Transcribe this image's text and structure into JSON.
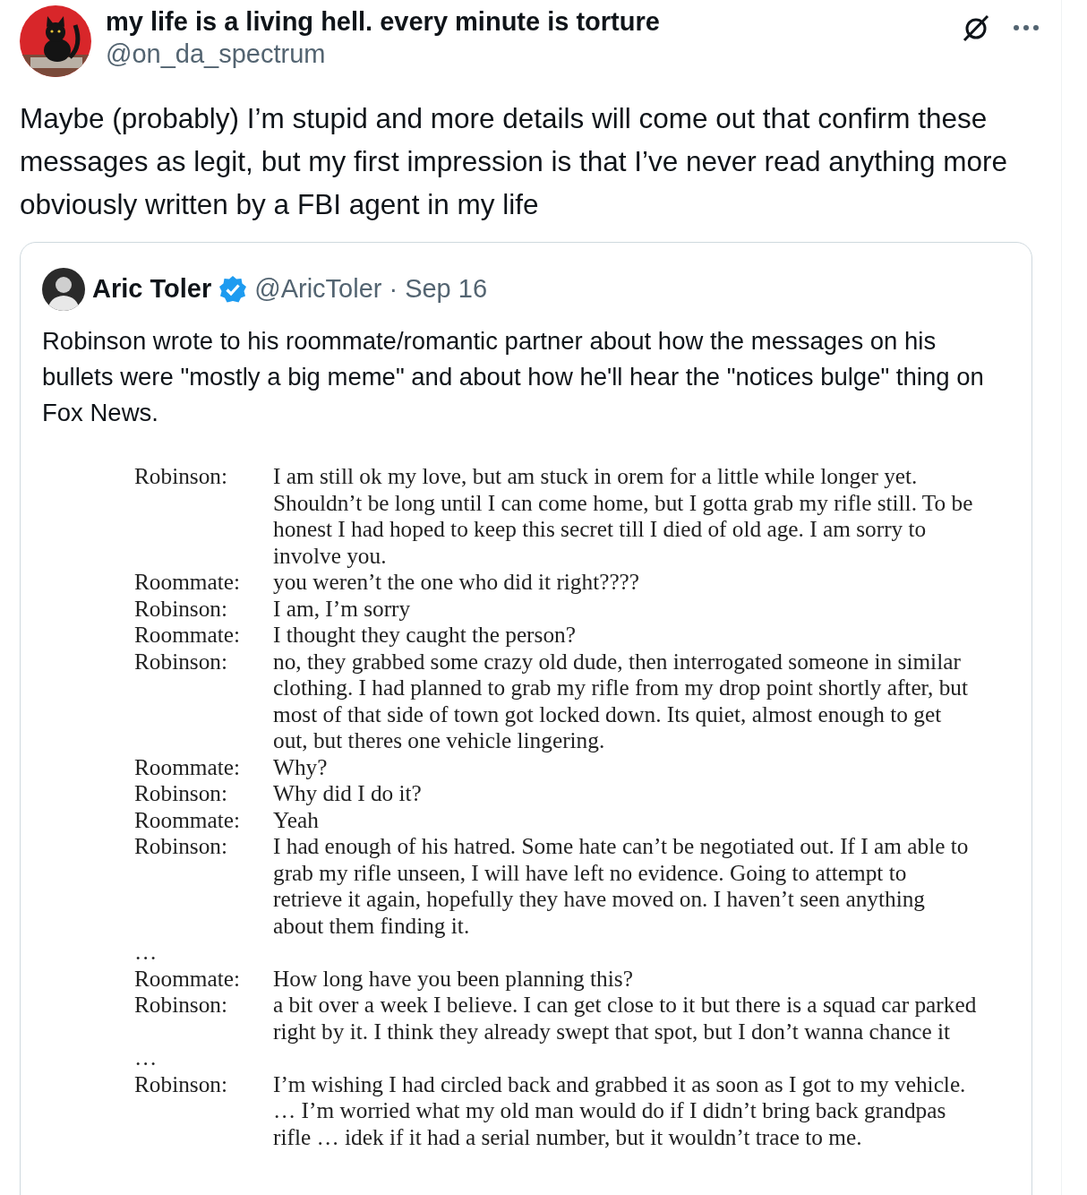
{
  "post": {
    "author": {
      "name": "my life is a living hell. every minute is torture",
      "handle": "@on_da_spectrum"
    },
    "text": "Maybe (probably) I’m stupid and more details will come out that confirm these messages as legit, but my first impression is that I’ve never read anything more obviously written by a FBI agent in my life",
    "quote": {
      "author": {
        "name": "Aric Toler",
        "verified": true,
        "handle": "@AricToler",
        "separator": "·",
        "date": "Sep 16"
      },
      "text": "Robinson wrote to his roommate/romantic partner about how the messages on his bullets were \"mostly a big meme\" and about how he'll hear the \"notices bulge\" thing on Fox News.",
      "document": {
        "entries": [
          {
            "kind": "line",
            "speaker": "Robinson:",
            "message": "I am still ok my love, but am stuck in orem for a little while longer yet. Shouldn’t be long until I can come home, but I gotta grab my rifle still. To be honest I had hoped to keep this secret till I died of old age. I am sorry to involve you."
          },
          {
            "kind": "line",
            "speaker": "Roommate:",
            "message": "you weren’t the one who did it right????"
          },
          {
            "kind": "line",
            "speaker": "Robinson:",
            "message": "I am, I’m sorry"
          },
          {
            "kind": "line",
            "speaker": "Roommate:",
            "message": "I thought they caught the person?"
          },
          {
            "kind": "line",
            "speaker": "Robinson:",
            "message": "no, they grabbed some crazy old dude, then interrogated someone in similar clothing. I had planned to grab my rifle from my drop point shortly after, but most of that side of town got locked down. Its quiet, almost enough to get out, but theres one vehicle lingering."
          },
          {
            "kind": "line",
            "speaker": "Roommate:",
            "message": "Why?"
          },
          {
            "kind": "line",
            "speaker": "Robinson:",
            "message": "Why did I do it?"
          },
          {
            "kind": "line",
            "speaker": "Roommate:",
            "message": "Yeah"
          },
          {
            "kind": "line",
            "speaker": "Robinson:",
            "message": "I had enough of his hatred. Some hate can’t be negotiated out. If I am able to grab my rifle unseen, I will have left no evidence. Going to attempt to retrieve it again, hopefully they have moved on. I haven’t seen anything about them finding it."
          },
          {
            "kind": "ellipsis",
            "text": "…"
          },
          {
            "kind": "line",
            "speaker": "Roommate:",
            "message": "How long have you been planning this?"
          },
          {
            "kind": "line",
            "speaker": "Robinson:",
            "message": "a bit over a week I believe. I can get close to it but there is a squad car parked right by it. I think they already swept that spot, but I don’t wanna chance it"
          },
          {
            "kind": "ellipsis",
            "text": "…"
          },
          {
            "kind": "line",
            "speaker": "Robinson:",
            "message": "I’m wishing I had circled back and grabbed it as soon as I got to my vehicle. … I’m worried what my old man would do if I didn’t bring back grandpas rifle … idek if it had a serial number, but it wouldn’t trace to me."
          }
        ]
      }
    }
  }
}
